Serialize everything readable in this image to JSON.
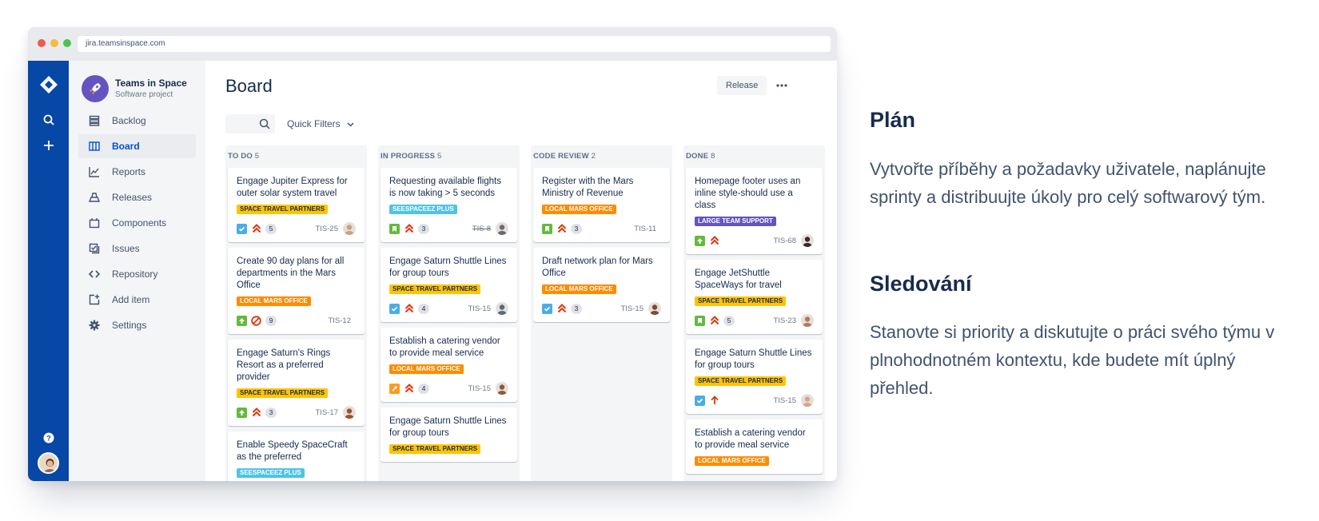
{
  "browser": {
    "url": "jira.teamsinspace.com"
  },
  "project": {
    "name": "Teams in Space",
    "type": "Software project"
  },
  "sidebar": {
    "items": [
      {
        "label": "Backlog",
        "icon": "backlog-icon"
      },
      {
        "label": "Board",
        "icon": "board-icon",
        "active": true
      },
      {
        "label": "Reports",
        "icon": "reports-icon"
      },
      {
        "label": "Releases",
        "icon": "releases-icon"
      },
      {
        "label": "Components",
        "icon": "components-icon"
      },
      {
        "label": "Issues",
        "icon": "issues-icon"
      },
      {
        "label": "Repository",
        "icon": "repository-icon"
      },
      {
        "label": "Add item",
        "icon": "add-item-icon"
      },
      {
        "label": "Settings",
        "icon": "settings-icon"
      }
    ]
  },
  "board": {
    "title": "Board",
    "release_label": "Release",
    "quick_filters_label": "Quick Filters",
    "columns": [
      {
        "title": "TO DO",
        "count": "5",
        "cards": [
          {
            "title": "Engage Jupiter Express for outer solar system travel",
            "label": "SPACE TRAVEL PARTNERS",
            "label_color": "yellow",
            "type": "task",
            "priority": "highest",
            "points": "5",
            "key": "TIS-25",
            "avatar": "#c9a27e"
          },
          {
            "title": "Create 90 day plans for all departments in the Mars Office",
            "label": "LOCAL MARS OFFICE",
            "label_color": "orange",
            "type": "story",
            "priority": "blocker",
            "points": "9",
            "key": "TIS-12",
            "avatar": ""
          },
          {
            "title": "Engage Saturn's Rings Resort as a preferred provider",
            "label": "SPACE TRAVEL PARTNERS",
            "label_color": "yellow",
            "type": "story",
            "priority": "highest",
            "points": "3",
            "key": "TIS-17",
            "avatar": "#a0522d"
          },
          {
            "title": "Enable Speedy SpaceCraft as the preferred",
            "label": "SEESPACEEZ PLUS",
            "label_color": "cyan",
            "type": "",
            "priority": "",
            "points": "",
            "key": "",
            "avatar": ""
          }
        ]
      },
      {
        "title": "IN PROGRESS",
        "count": "5",
        "cards": [
          {
            "title": "Requesting available flights is now taking > 5 seconds",
            "label": "SEESPACEEZ PLUS",
            "label_color": "cyan",
            "type": "bookmark",
            "priority": "highest",
            "points": "3",
            "key": "TIS-8",
            "key_done": true,
            "avatar": "#6b6b6b"
          },
          {
            "title": "Engage Saturn Shuttle Lines for group tours",
            "label": "SPACE TRAVEL PARTNERS",
            "label_color": "yellow",
            "type": "task",
            "priority": "highest",
            "points": "4",
            "key": "TIS-15",
            "avatar": "#5a6b7a"
          },
          {
            "title": "Establish a catering vendor to provide meal service",
            "label": "LOCAL MARS OFFICE",
            "label_color": "orange",
            "type": "improvement",
            "priority": "highest",
            "points": "4",
            "key": "TIS-15",
            "avatar": "#8b5a3c"
          },
          {
            "title": "Engage Saturn Shuttle Lines for group tours",
            "label": "SPACE TRAVEL PARTNERS",
            "label_color": "yellow",
            "type": "",
            "priority": "",
            "points": "",
            "key": "",
            "avatar": ""
          }
        ]
      },
      {
        "title": "CODE REVIEW",
        "count": "2",
        "cards": [
          {
            "title": "Register with the Mars Ministry of Revenue",
            "label": "LOCAL MARS OFFICE",
            "label_color": "orange",
            "type": "bookmark",
            "priority": "highest",
            "points": "3",
            "key": "TIS-11",
            "avatar": ""
          },
          {
            "title": "Draft network plan for Mars Office",
            "label": "LOCAL MARS OFFICE",
            "label_color": "orange",
            "type": "task",
            "priority": "highest",
            "points": "3",
            "key": "TIS-15",
            "avatar": "#7a4a3a"
          }
        ]
      },
      {
        "title": "DONE",
        "count": "8",
        "cards": [
          {
            "title": "Homepage footer uses an inline style-should use a class",
            "label": "LARGE TEAM SUPPORT",
            "label_color": "purple",
            "type": "story",
            "priority": "highest",
            "points": "",
            "key": "TIS-68",
            "avatar": "#3a2a2a"
          },
          {
            "title": "Engage JetShuttle SpaceWays for travel",
            "label": "SPACE TRAVEL PARTNERS",
            "label_color": "yellow",
            "type": "bookmark",
            "priority": "highest",
            "points": "5",
            "key": "TIS-23",
            "avatar": "#b07a5a"
          },
          {
            "title": "Engage Saturn Shuttle Lines for group tours",
            "label": "SPACE TRAVEL PARTNERS",
            "label_color": "yellow",
            "type": "task",
            "priority": "high",
            "points": "",
            "key": "TIS-15",
            "avatar": "#d4a58a"
          },
          {
            "title": "Establish a catering vendor to provide meal service",
            "label": "LOCAL MARS OFFICE",
            "label_color": "orange",
            "type": "",
            "priority": "",
            "points": "",
            "key": "",
            "avatar": ""
          }
        ]
      }
    ]
  },
  "copy": {
    "plan_heading": "Plán",
    "plan_text": "Vytvořte příběhy a požadavky uživatele, naplánujte sprinty a distribuujte úkoly pro celý softwarový tým.",
    "track_heading": "Sledování",
    "track_text": "Stanovte si priority a diskutujte o práci svého týmu v plnohodnotném kontextu, kde budete mít úplný přehled."
  },
  "colors": {
    "nav_blue": "#0747a6",
    "link_blue": "#0052cc"
  }
}
